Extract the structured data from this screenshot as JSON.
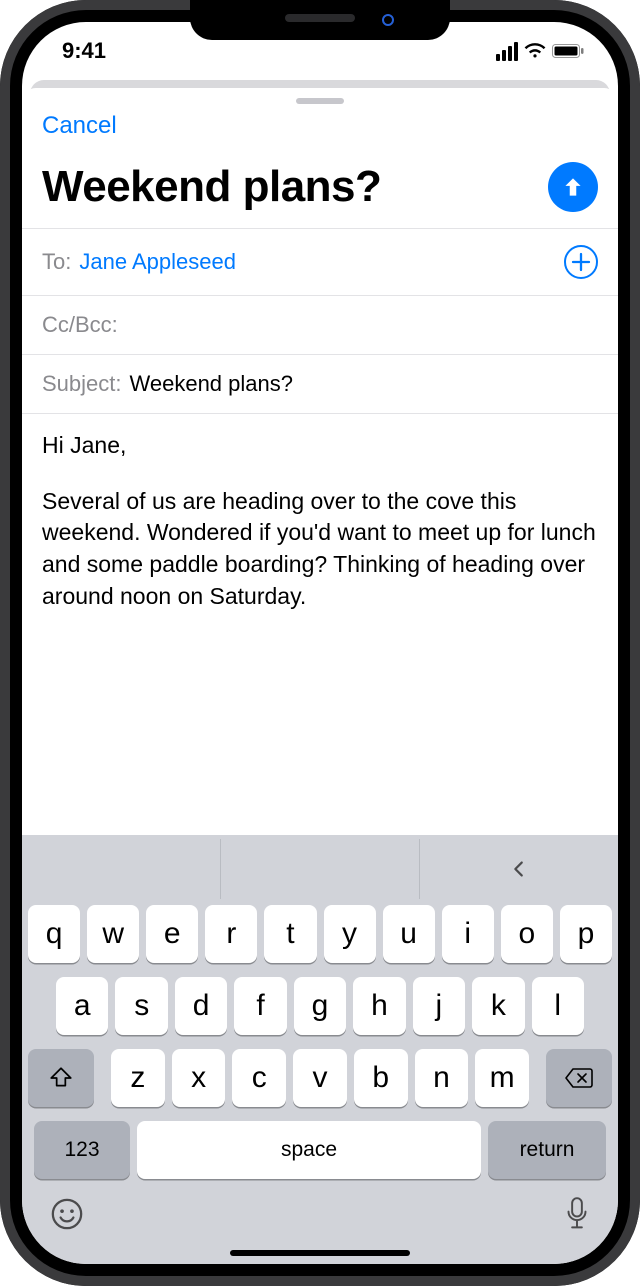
{
  "status": {
    "time": "9:41"
  },
  "compose": {
    "cancel": "Cancel",
    "title": "Weekend plans?",
    "to_label": "To:",
    "to_value": "Jane Appleseed",
    "ccbcc_label": "Cc/Bcc:",
    "subject_label": "Subject:",
    "subject_value": "Weekend plans?",
    "body_greeting": "Hi Jane,",
    "body_text": "Several of us are heading over to the cove this weekend. Wondered if you'd want to meet up for lunch and some paddle boarding? Thinking of heading over around noon on Saturday."
  },
  "keyboard": {
    "row1": [
      "q",
      "w",
      "e",
      "r",
      "t",
      "y",
      "u",
      "i",
      "o",
      "p"
    ],
    "row2": [
      "a",
      "s",
      "d",
      "f",
      "g",
      "h",
      "j",
      "k",
      "l"
    ],
    "row3": [
      "z",
      "x",
      "c",
      "v",
      "b",
      "n",
      "m"
    ],
    "numkey": "123",
    "space": "space",
    "return": "return"
  }
}
